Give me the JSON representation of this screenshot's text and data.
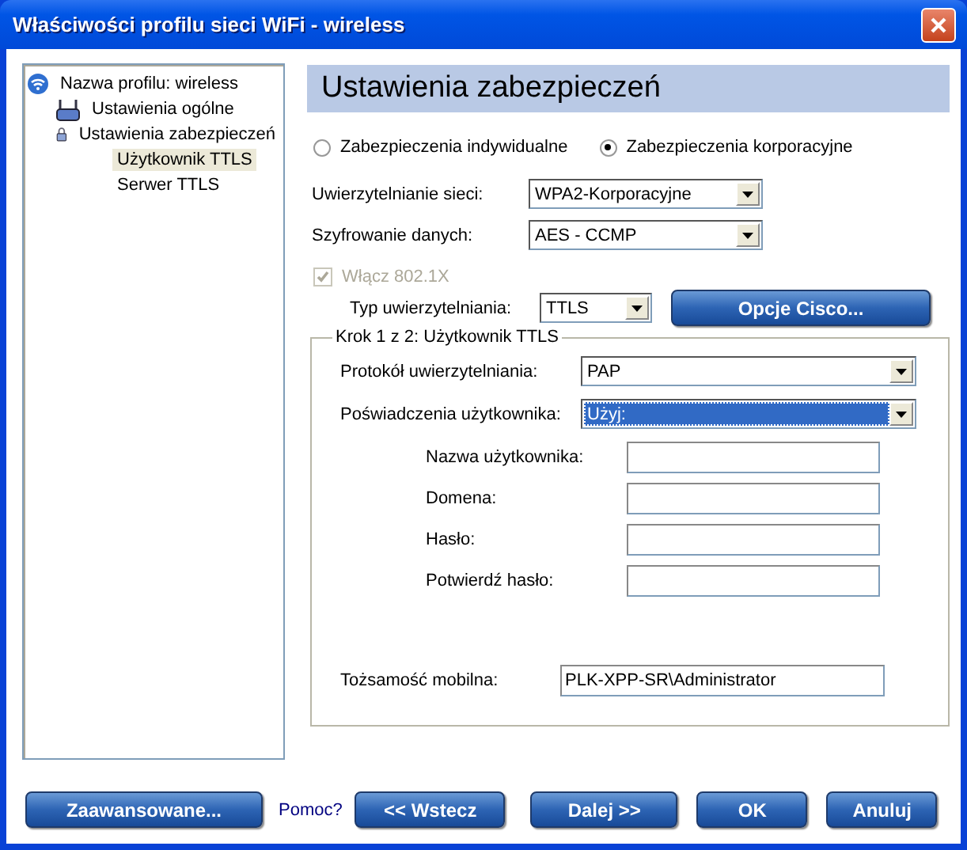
{
  "window": {
    "title": "Właściwości profilu sieci WiFi - wireless"
  },
  "tree": [
    {
      "label": "Nazwa profilu: wireless",
      "kind": "wifi",
      "selected": false,
      "children": [
        {
          "label": "Ustawienia ogólne",
          "kind": "router",
          "selected": false
        },
        {
          "label": "Ustawienia zabezpieczeń",
          "kind": "lock",
          "selected": false,
          "children": [
            {
              "label": "Użytkownik TTLS",
              "kind": "plain",
              "selected": true
            },
            {
              "label": "Serwer TTLS",
              "kind": "plain",
              "selected": false
            }
          ]
        }
      ]
    }
  ],
  "panel": {
    "title": "Ustawienia zabezpieczeń"
  },
  "radios": [
    {
      "label": "Zabezpieczenia indywidualne",
      "selected": false
    },
    {
      "label": "Zabezpieczenia korporacyjne",
      "selected": true
    }
  ],
  "network_auth": {
    "label": "Uwierzytelnianie sieci:",
    "value": "WPA2-Korporacyjne"
  },
  "encryption": {
    "label": "Szyfrowanie danych:",
    "value": "AES - CCMP"
  },
  "enable_8021x": {
    "label": "Włącz 802.1X",
    "checked": true,
    "disabled": true
  },
  "auth_type": {
    "label": "Typ uwierzytelniania:",
    "value": "TTLS"
  },
  "cisco_button": "Opcje Cisco...",
  "group": {
    "title": "Krok 1 z 2: Użytkownik TTLS",
    "protocol": {
      "label": "Protokół uwierzytelniania:",
      "value": "PAP",
      "focused": false
    },
    "credentials": {
      "label": "Poświadczenia użytkownika:",
      "value": "Użyj:",
      "focused": true
    },
    "fields": [
      {
        "label": "Nazwa użytkownika:"
      },
      {
        "label": "Domena:"
      },
      {
        "label": "Hasło:"
      },
      {
        "label": "Potwierdź hasło:"
      }
    ],
    "mobile_identity": {
      "label": "Tożsamość mobilna:",
      "value": "PLK-XPP-SR\\Administrator"
    }
  },
  "footer": {
    "advanced": "Zaawansowane...",
    "help": "Pomoc?",
    "back": "<< Wstecz",
    "next": "Dalej >>",
    "ok": "OK",
    "cancel": "Anuluj"
  }
}
